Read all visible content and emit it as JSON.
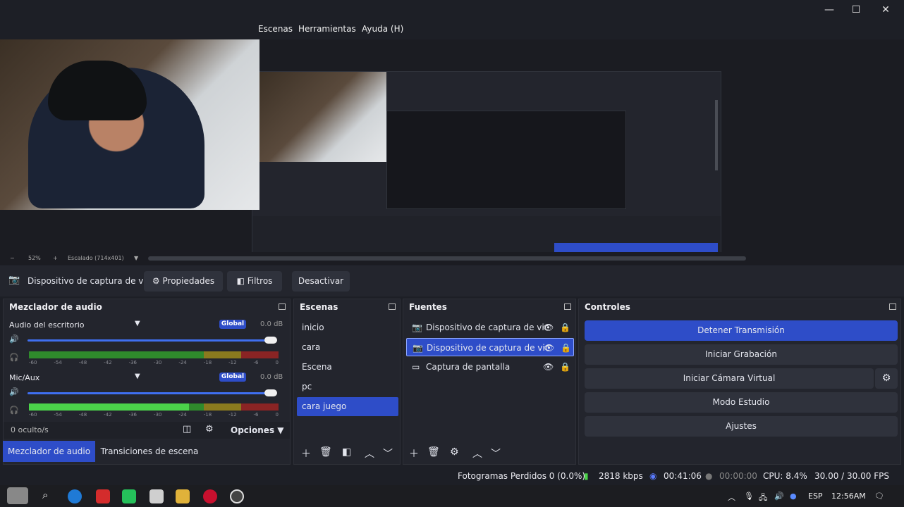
{
  "window": {
    "minimize_glyph": "—",
    "maximize_glyph": "☐",
    "close_glyph": "✕"
  },
  "menu": {
    "items": [
      "Escenas",
      "Herramientas",
      "Ayuda (H)"
    ]
  },
  "zoom": {
    "minus": "−",
    "percent": "52%",
    "plus": "+",
    "scale_label": "Escalado (714x401)"
  },
  "source_toolbar": {
    "camera_icon": "camera-icon",
    "source_name": "Dispositivo de captura de v",
    "properties": "Propiedades",
    "filters": "Filtros",
    "deactivate": "Desactivar"
  },
  "audio_mixer": {
    "title": "Mezclador de audio",
    "channels": [
      {
        "name": "Audio del escritorio",
        "badge": "Global",
        "db": "0.0 dB",
        "level": 0.0
      },
      {
        "name": "Mic/Aux",
        "badge": "Global",
        "db": "0.0 dB",
        "level": 0.64
      }
    ],
    "scale": [
      "-60",
      "-54",
      "-48",
      "-42",
      "-36",
      "-30",
      "-24",
      "-18",
      "-12",
      "-6",
      "0"
    ],
    "hidden_count": "0 oculto/s",
    "options": "Opciones"
  },
  "scenes": {
    "title": "Escenas",
    "items": [
      "inicio",
      "cara",
      "Escena",
      "pc",
      "cara juego"
    ],
    "selected_index": 4
  },
  "sources": {
    "title": "Fuentes",
    "items": [
      {
        "name": "Dispositivo de captura de vic",
        "icon": "camera-icon"
      },
      {
        "name": "Dispositivo de captura de vic",
        "icon": "camera-icon"
      },
      {
        "name": "Captura de pantalla",
        "icon": "monitor-icon"
      }
    ],
    "selected_index": 1
  },
  "controls": {
    "title": "Controles",
    "stop_stream": "Detener Transmisión",
    "start_recording": "Iniciar Grabación",
    "start_virtual_cam": "Iniciar Cámara Virtual",
    "studio_mode": "Modo Estudio",
    "settings": "Ajustes"
  },
  "tabs": {
    "audio_mixer": "Mezclador de audio",
    "scene_transitions": "Transiciones de escena"
  },
  "status": {
    "dropped_frames": "Fotogramas Perdidos 0 (0.0%)",
    "bitrate": "2818 kbps",
    "stream_time": "00:41:06",
    "rec_time": "00:00:00",
    "cpu": "CPU: 8.4%",
    "fps": "30.00 / 30.00 FPS"
  },
  "taskbar": {
    "language": "ESP",
    "time": "12:56AM"
  },
  "colors": {
    "accent": "#2e4dc8",
    "panel": "#23252d",
    "background": "#1d1f26"
  }
}
